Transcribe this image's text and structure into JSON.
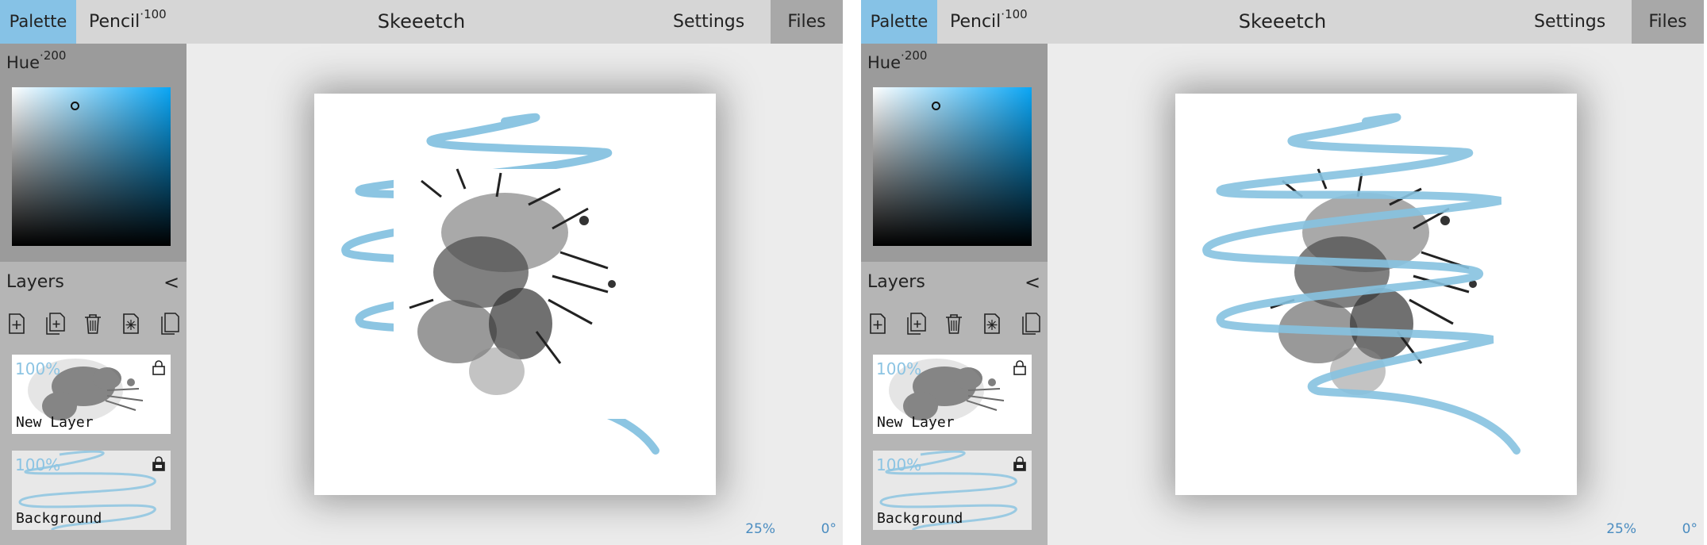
{
  "apps": [
    {
      "topbar": {
        "palette": "Palette",
        "pencil": "Pencil",
        "pencil_size": "100",
        "title": "Skeeetch",
        "settings": "Settings",
        "files": "Files"
      },
      "color": {
        "hue_label": "Hue",
        "hue_value": "200",
        "accent": "#0aa6f5"
      },
      "layers": {
        "title": "Layers",
        "collapse": "<",
        "items": [
          {
            "name": "New Layer",
            "opacity": "100%",
            "lock": "lock-icon"
          },
          {
            "name": "Background",
            "opacity": "100%",
            "lock": "lock-icon"
          }
        ]
      },
      "status": {
        "zoom": "25%",
        "angle": "0°"
      }
    },
    {
      "topbar": {
        "palette": "Palette",
        "pencil": "Pencil",
        "pencil_size": "100",
        "title": "Skeeetch",
        "settings": "Settings",
        "files": "Files"
      },
      "color": {
        "hue_label": "Hue",
        "hue_value": "200",
        "accent": "#0aa6f5"
      },
      "layers": {
        "title": "Layers",
        "collapse": "<",
        "items": [
          {
            "name": "New Layer",
            "opacity": "100%",
            "lock": "lock-icon"
          },
          {
            "name": "Background",
            "opacity": "100%",
            "lock": "lock-icon"
          }
        ]
      },
      "status": {
        "zoom": "25%",
        "angle": "0°"
      }
    }
  ],
  "stroke_color": "#86c2e0"
}
